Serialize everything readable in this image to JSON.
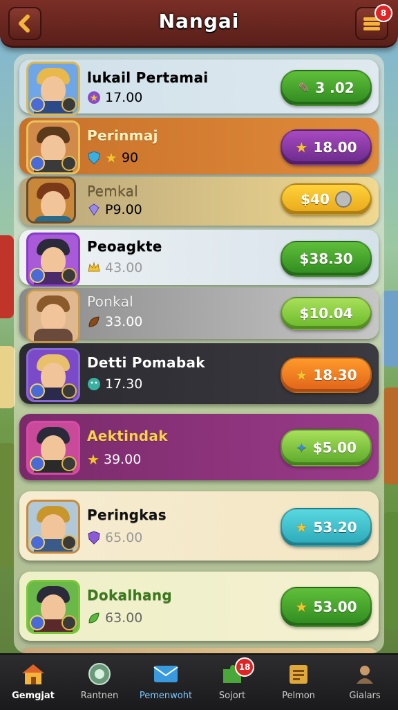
{
  "header": {
    "title": "Nangai",
    "menu_badge": "8"
  },
  "rows": [
    {
      "name": "lukail Pertamai",
      "value": "17.00",
      "price": "3 .02",
      "name_color": "#f2d64b",
      "value_color": "#555"
    },
    {
      "name": "Perinmaj",
      "value": "90",
      "price": "18.00",
      "name_color": "#fff3c0",
      "value_color": "#fff"
    },
    {
      "name": "Pemkal",
      "value": "P9.00",
      "price": "$40",
      "name_color": "#6a5a3a",
      "value_color": "#4a3a2a"
    },
    {
      "name": "Peoagkte",
      "value": "43.00",
      "price": "$38.30",
      "name_color": "#111",
      "value_color": "#888"
    },
    {
      "name": "Ponkal",
      "value": "33.00",
      "price": "$10.04",
      "name_color": "#eee",
      "value_color": "#fff"
    },
    {
      "name": "Detti Pomabak",
      "value": "17.30",
      "price": "18.30",
      "name_color": "#fff",
      "value_color": "#fff"
    },
    {
      "name": "Aektindak",
      "value": "39.00",
      "price": "$5.00",
      "name_color": "#f7d24a",
      "value_color": "#fff"
    },
    {
      "name": "Peringkas",
      "value": "65.00",
      "price": "53.20",
      "name_color": "#111",
      "value_color": "#999"
    },
    {
      "name": "Dokalhang",
      "value": "63.00",
      "price": "53.00",
      "name_color": "#3a7a1a",
      "value_color": "#666"
    }
  ],
  "nav": [
    {
      "label": "Gemgjat",
      "icon": "home-icon",
      "active": true
    },
    {
      "label": "Rantnen",
      "icon": "globe-icon",
      "active": false
    },
    {
      "label": "Pemenwoht",
      "icon": "mail-icon",
      "active": false
    },
    {
      "label": "Sojort",
      "icon": "puzzle-icon",
      "active": false,
      "badge": "18"
    },
    {
      "label": "Pelmon",
      "icon": "clipboard-icon",
      "active": false
    },
    {
      "label": "Gialars",
      "icon": "user-icon",
      "active": false
    }
  ]
}
